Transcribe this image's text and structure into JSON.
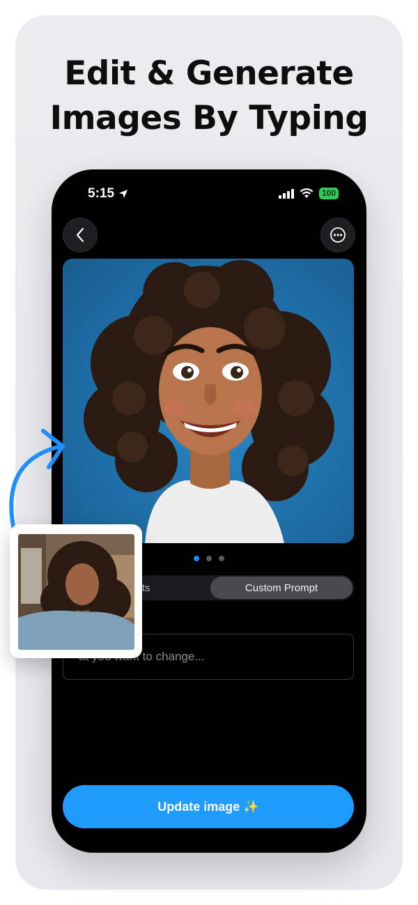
{
  "headline": {
    "line1": "Edit & Generate",
    "line2": "Images By Typing"
  },
  "status_bar": {
    "time": "5:15",
    "battery": "100"
  },
  "nav": {
    "back_icon": "chevron-left-icon",
    "more_icon": "ellipsis-circle-icon"
  },
  "carousel": {
    "page_count": 3,
    "active_index": 0
  },
  "tabs": {
    "left_label": "ompts",
    "right_label": "Custom Prompt"
  },
  "prompt": {
    "placeholder": "at you want to change..."
  },
  "action": {
    "update_label": "Update image ✨"
  },
  "colors": {
    "accent": "#1e9bff",
    "phone_bg": "#000000",
    "card_bg": "#ececef",
    "battery": "#34c759",
    "photo_bg": "#2a86c4"
  }
}
